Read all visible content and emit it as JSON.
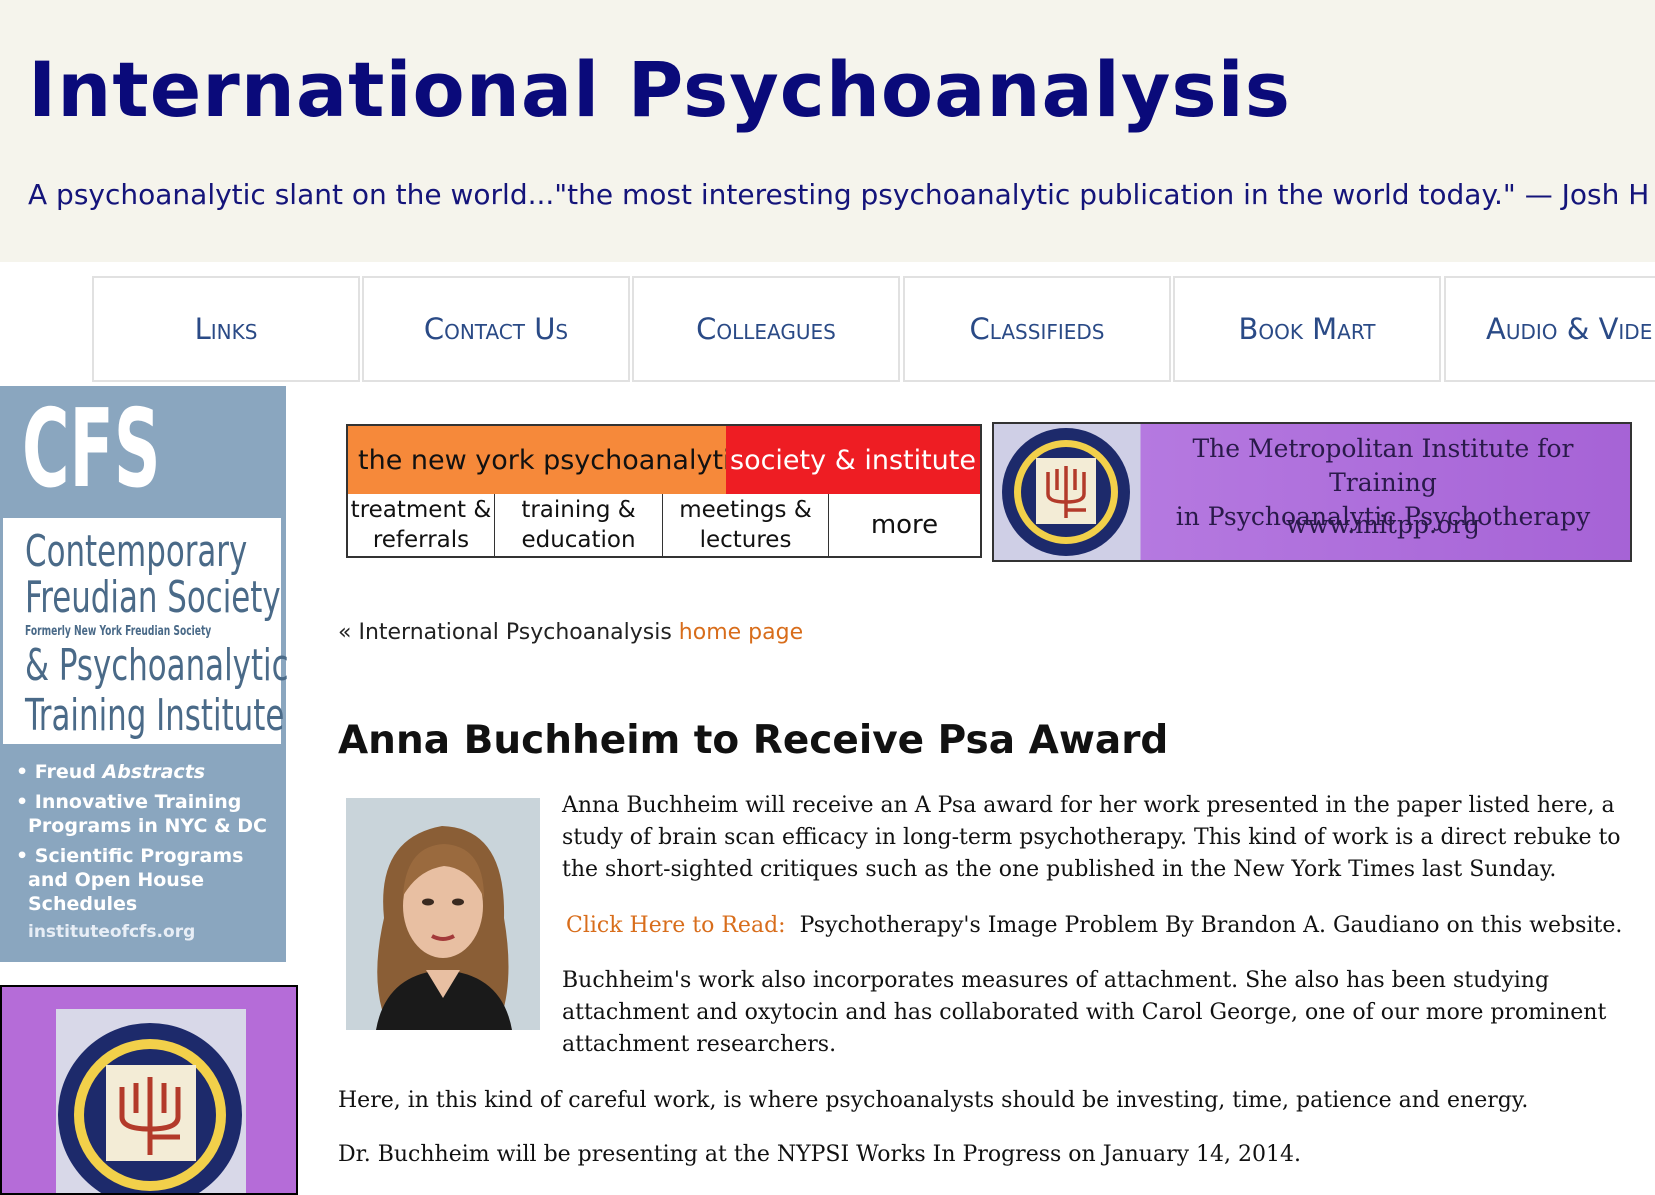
{
  "header": {
    "title": "International Psychoanalysis",
    "tagline": "A psychoanalytic slant on the world...\"the most interesting psychoanalytic publication in the world today.\" — Josh H"
  },
  "nav": {
    "items": [
      {
        "label": "Links"
      },
      {
        "label": "Contact Us"
      },
      {
        "label": "Colleagues"
      },
      {
        "label": "Classifieds"
      },
      {
        "label": "Book Mart"
      },
      {
        "label": "Audio & Vide"
      }
    ]
  },
  "cfs_ad": {
    "logo": "CFS",
    "line1": "Contemporary",
    "line2": "Freudian Society",
    "line3": "Formerly New York Freudian Society",
    "line4": "& Psychoanalytic",
    "line5": "Training Institute",
    "bullet1_a": "Freud",
    "bullet1_b": "Abstracts",
    "bullet2": "Innovative Training Programs in NYC & DC",
    "bullet3": "Scientific Programs and Open House Schedules",
    "url": "instituteofcfs.org"
  },
  "nyp_ad": {
    "top_left": "the new york psychoanalytic",
    "top_right": "society & institute",
    "cell1": "treatment & referrals",
    "cell2": "training & education",
    "cell3": "meetings & lectures",
    "cell4": "more"
  },
  "mitpp_ad": {
    "line1": "The Metropolitan Institute for Training",
    "line2": "in Psychoanalytic Psychotherapy",
    "url": "www.mitpp.org"
  },
  "breadcrumb": {
    "prefix": "« International Psychoanalysis",
    "link": "home page"
  },
  "article": {
    "title": "Anna Buchheim to Receive Psa Award",
    "para1": "Anna Buchheim will receive an A Psa award for her work presented in the paper listed here, a study of brain scan efficacy in long-term psychotherapy. This kind of work is a direct rebuke to the short-sighted critiques such as the one published in the New York Times last Sunday.",
    "click_label": "Click Here to Read:",
    "click_text": "Psychotherapy's Image Problem By Brandon A. Gaudiano on this website.",
    "para2": "Buchheim's work also incorporates measures of attachment. She also has been studying attachment and oxytocin and has collaborated with Carol George, one of our more prominent attachment researchers.",
    "para3": "Here, in this kind of careful work, is where psychoanalysts should be investing, time, patience and energy.",
    "para4": "Dr. Buchheim will be presenting at the NYPSI Works In Progress on January 14, 2014."
  }
}
